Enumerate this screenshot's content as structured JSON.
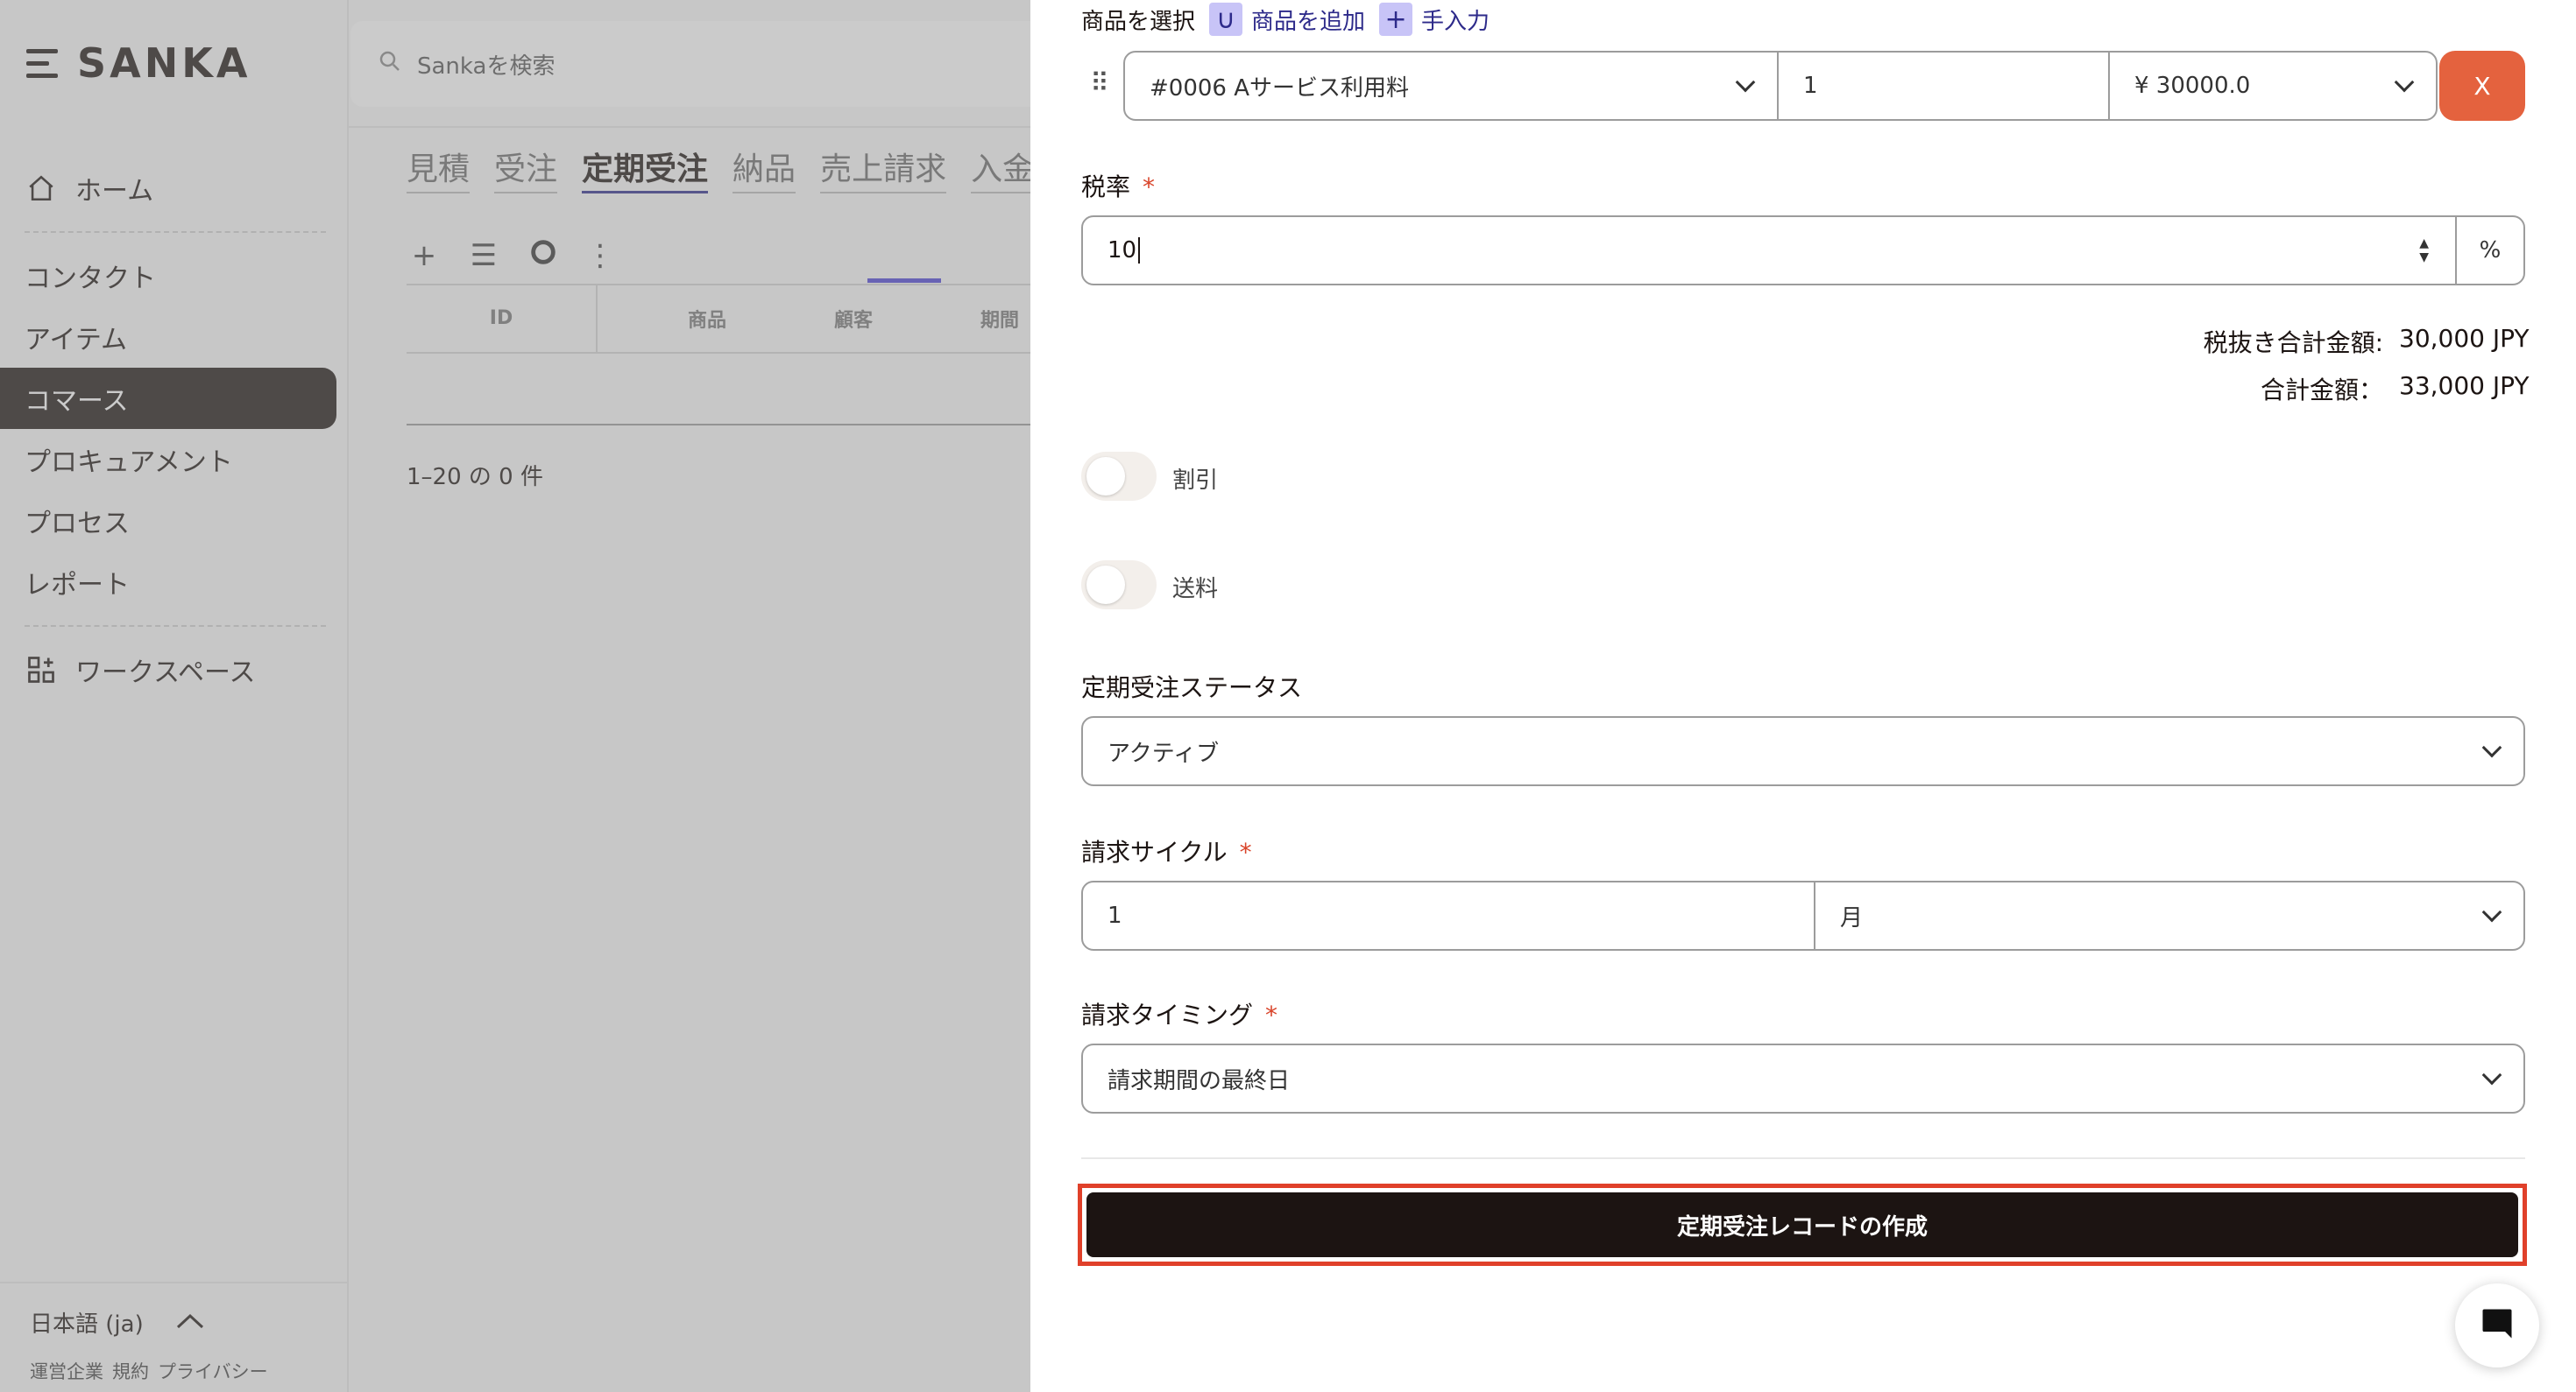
{
  "app": {
    "brand": "SANKA",
    "search_placeholder": "Sankaを検索"
  },
  "sidebar": {
    "home": "ホーム",
    "items": [
      "コンタクト",
      "アイテム",
      "コマース",
      "プロキュアメント",
      "プロセス",
      "レポート"
    ],
    "workspace": "ワークスペース",
    "language": "日本語 (ja)",
    "legal": [
      "運営企業",
      "規約",
      "プライバシー"
    ]
  },
  "main": {
    "tabs": [
      "見積",
      "受注",
      "定期受注",
      "納品",
      "売上請求",
      "入金"
    ],
    "active_tab": "定期受注",
    "columns": [
      "ID",
      "商品",
      "顧客",
      "期間"
    ],
    "pagination": "1–20 の 0 件"
  },
  "panel": {
    "product_select_label": "商品を選択",
    "add_product_link": "商品を追加",
    "manual_input_link": "手入力",
    "line_item": {
      "product": "#0006 Aサービス利用料",
      "quantity": "1",
      "price": "¥ 30000.0",
      "remove_label": "X"
    },
    "tax_rate": {
      "label": "税率",
      "value": "10",
      "unit": "%"
    },
    "totals": {
      "subtotal_label": "税抜き合計金額:",
      "subtotal_value": "30,000 JPY",
      "total_label": "合計金額：",
      "total_value": "33,000 JPY"
    },
    "discount_label": "割引",
    "shipping_label": "送料",
    "status": {
      "label": "定期受注ステータス",
      "value": "アクティブ"
    },
    "billing_cycle": {
      "label": "請求サイクル",
      "value": "1",
      "unit": "月"
    },
    "billing_timing": {
      "label": "請求タイミング",
      "value": "請求期間の最終日"
    },
    "submit_label": "定期受注レコードの作成"
  },
  "colors": {
    "primary_dark": "#1c1412",
    "accent_blue": "#2d2a8a",
    "remove_button": "#e4623e",
    "highlight_outline": "#e0402a",
    "required_star": "#d9452b"
  }
}
